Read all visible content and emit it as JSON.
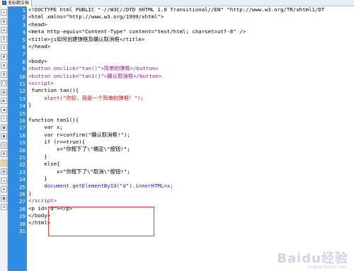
{
  "window": {
    "tab_title": "无标题文档"
  },
  "toolbar": {
    "tools": [
      {
        "name": "code-view-tool",
        "glyph": "◇"
      },
      {
        "name": "split-view-tool",
        "glyph": "※"
      },
      {
        "name": "expand-tool",
        "glyph": "≡"
      },
      {
        "name": "collapse-tool",
        "glyph": "‡"
      },
      {
        "name": "select-tool",
        "glyph": "±"
      },
      {
        "name": "line-numbers-tool",
        "glyph": "#"
      },
      {
        "name": "highlight-tool",
        "glyph": "◈"
      },
      {
        "name": "wrap-tool",
        "glyph": "≣"
      },
      {
        "name": "comment-tool",
        "glyph": "()"
      },
      {
        "name": "uncomment-tool",
        "glyph": "▤"
      },
      {
        "name": "indent-tool",
        "glyph": "▶"
      },
      {
        "name": "outdent-tool",
        "glyph": "◀"
      },
      {
        "name": "format-tool",
        "glyph": "✎"
      },
      {
        "name": "format-source-tool",
        "glyph": "▦"
      },
      {
        "name": "apply-tool",
        "glyph": "▣"
      },
      {
        "name": "snippet-tool",
        "glyph": "◳"
      },
      {
        "name": "insert-tool",
        "glyph": "⊞"
      },
      {
        "name": "tag-tool",
        "glyph": "◰"
      },
      {
        "name": "recent-tool",
        "glyph": "▥"
      },
      {
        "name": "move-tool",
        "glyph": "⇲"
      },
      {
        "name": "zoom-tool",
        "glyph": "⊕"
      },
      {
        "name": "debug-tool",
        "glyph": "▩"
      },
      {
        "name": "list-tool",
        "glyph": "≋"
      }
    ]
  },
  "editor": {
    "line_numbers": [
      "1",
      "2",
      "3",
      "4",
      "5",
      "6",
      "7",
      "8",
      "9",
      "10",
      "11",
      "12",
      "13",
      "14",
      "15",
      "16",
      "17",
      "18",
      "19",
      "20",
      "21",
      "22",
      "23",
      "24",
      "25",
      "26",
      "27",
      "28",
      "29",
      "30",
      "31"
    ],
    "lines": [
      "<!DOCTYPE html PUBLIC \"-//W3C//DTD XHTML 1.0 Transitional//EN\" \"http://www.w3.org/TR/xhtml1/DT",
      "<html xmlns=\"http://www.w3.org/1999/xhtml\">",
      "<head>",
      "<meta http-equiv=\"Content-Type\" content=\"text/html; charset=utf-8\" />",
      "<title>js如何创建弹框及确认取消框</title>",
      "</head>",
      "",
      "<body>",
      "<button onclick=\"tan()\">简单的弹框</button>",
      "<button onclick=\"tan1()\">确认取消框</button>",
      "<script>",
      " function tan(){",
      "     alert(\"你好，我是一个简单的弹框！\");",
      "}",
      "",
      "function tan1(){",
      "     var x;",
      "     var r=confirm(\"确认取消框!\");",
      "     if (r==true){",
      "         x=\"你按下了\\\"确定\\\"按钮!\";",
      "     }",
      "     else{",
      "         x=\"你按下了\\\"取消\\\"按钮!\";",
      "     }",
      "     document.getElementById(\"d\").innerHTML=x;",
      "}",
      "</script>",
      "<p id=\"d\"></p>",
      "</body>",
      "</html>",
      ""
    ]
  },
  "watermark": {
    "brand": "Baidu经验",
    "url": "jingyan.baidu.com"
  }
}
